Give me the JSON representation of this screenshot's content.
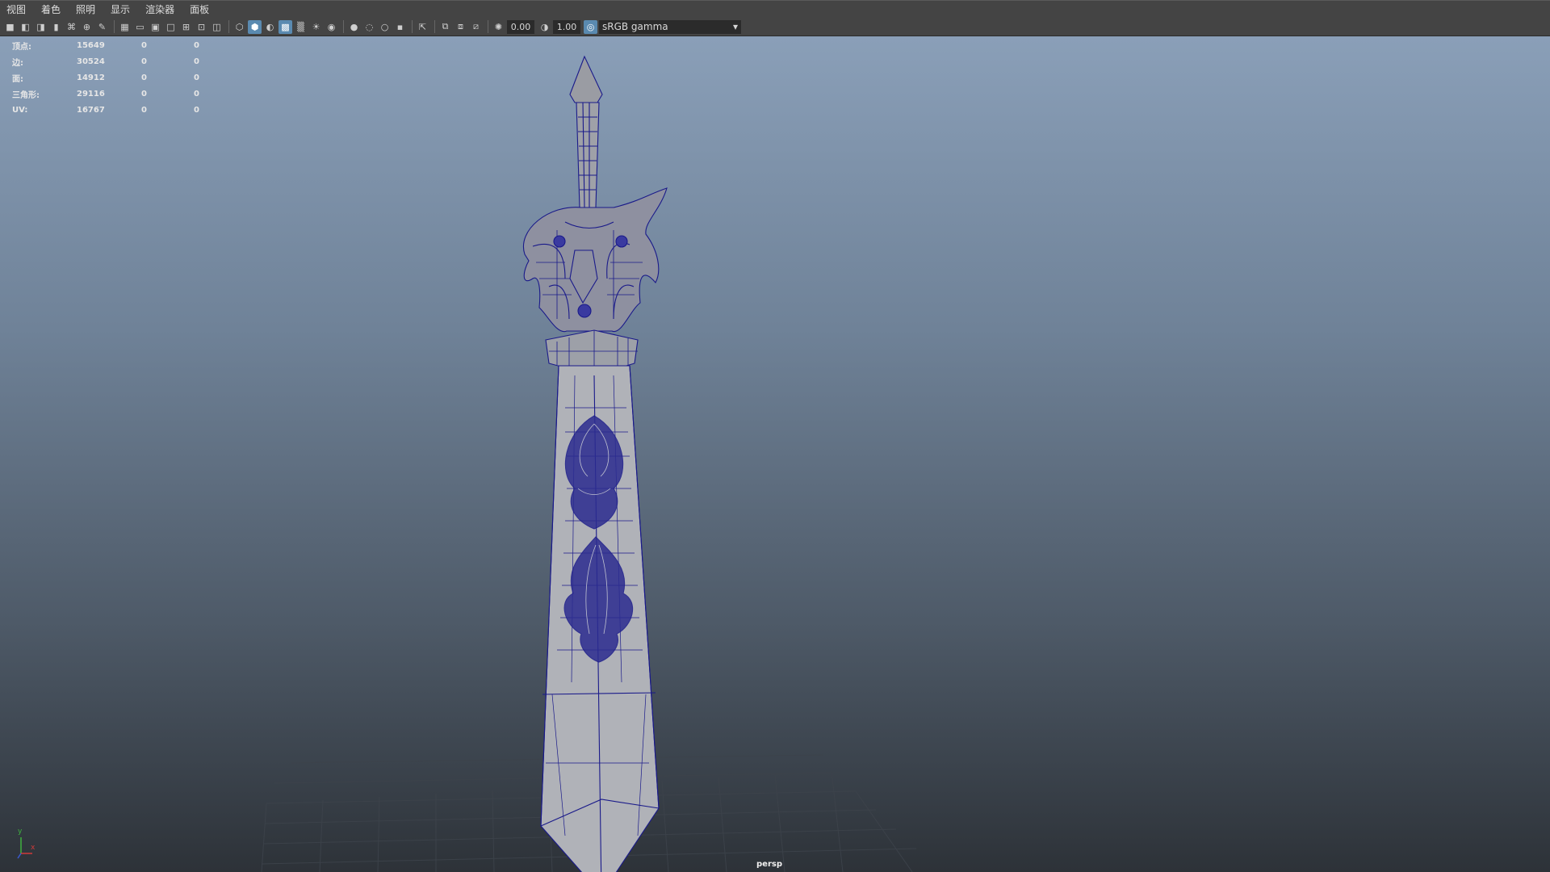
{
  "menu": [
    "视图",
    "着色",
    "照明",
    "显示",
    "渲染器",
    "面板"
  ],
  "toolbar": {
    "exposure_value": "0.00",
    "gamma_value": "1.00",
    "color_space": "sRGB gamma"
  },
  "hud": {
    "rows": [
      {
        "label": "顶点:",
        "value": "15649",
        "z1": "0",
        "z2": "0"
      },
      {
        "label": "边:",
        "value": "30524",
        "z1": "0",
        "z2": "0"
      },
      {
        "label": "面:",
        "value": "14912",
        "z1": "0",
        "z2": "0"
      },
      {
        "label": "三角形:",
        "value": "29116",
        "z1": "0",
        "z2": "0"
      },
      {
        "label": "UV:",
        "value": "16767",
        "z1": "0",
        "z2": "0"
      }
    ]
  },
  "viewport": {
    "camera_label": "persp",
    "axis_y": "y",
    "axis_x": "x"
  },
  "colors": {
    "wireframe": "#1a1a8a",
    "mesh_fill": "#aeb0b5",
    "menu_bg": "#444444"
  }
}
